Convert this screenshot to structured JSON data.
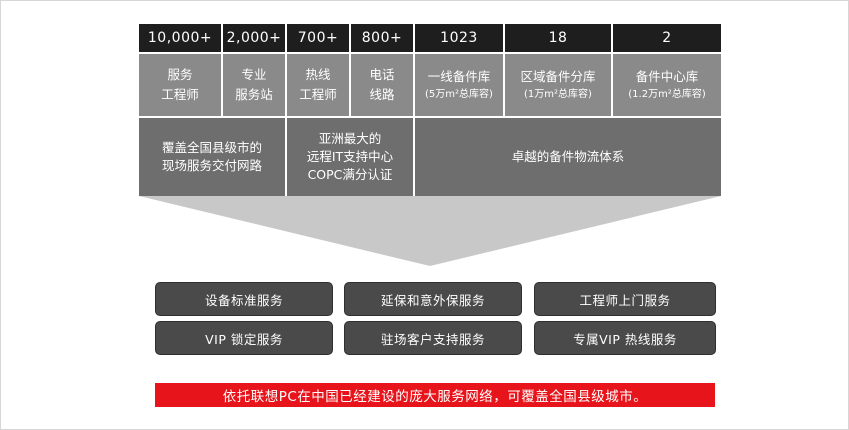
{
  "stats": [
    {
      "value": "10,000+",
      "label_lines": [
        "服务",
        "工程师"
      ],
      "sub": ""
    },
    {
      "value": "2,000+",
      "label_lines": [
        "专业",
        "服务站"
      ],
      "sub": ""
    },
    {
      "value": "700+",
      "label_lines": [
        "热线",
        "工程师"
      ],
      "sub": ""
    },
    {
      "value": "800+",
      "label_lines": [
        "电话",
        "线路"
      ],
      "sub": ""
    },
    {
      "value": "1023",
      "label_lines": [
        "一线备件库"
      ],
      "sub": "(5万m²总库容)"
    },
    {
      "value": "18",
      "label_lines": [
        "区域备件分库"
      ],
      "sub": "(1万m²总库容)"
    },
    {
      "value": "2",
      "label_lines": [
        "备件中心库"
      ],
      "sub": "(1.2万m²总库容)"
    }
  ],
  "descriptions": [
    {
      "lines": [
        "覆盖全国县级市的",
        "现场服务交付网路"
      ]
    },
    {
      "lines": [
        "亚洲最大的",
        "远程IT支持中心",
        "COPC满分认证"
      ]
    },
    {
      "lines": [
        "卓越的备件物流体系"
      ]
    }
  ],
  "services": [
    "设备标准服务",
    "延保和意外保服务",
    "工程师上门服务",
    "VIP 锁定服务",
    "驻场客户支持服务",
    "专属VIP 热线服务"
  ],
  "banner": "依托联想PC在中国已经建设的庞大服务网络，可覆盖全国县级城市。",
  "colors": {
    "number_row": "#1e1e1e",
    "label_row": "#8a8a8a",
    "description_row": "#6e6e6e",
    "funnel": "#c8c8c8",
    "service_button": "#4a4a4a",
    "banner": "#e8141b"
  }
}
